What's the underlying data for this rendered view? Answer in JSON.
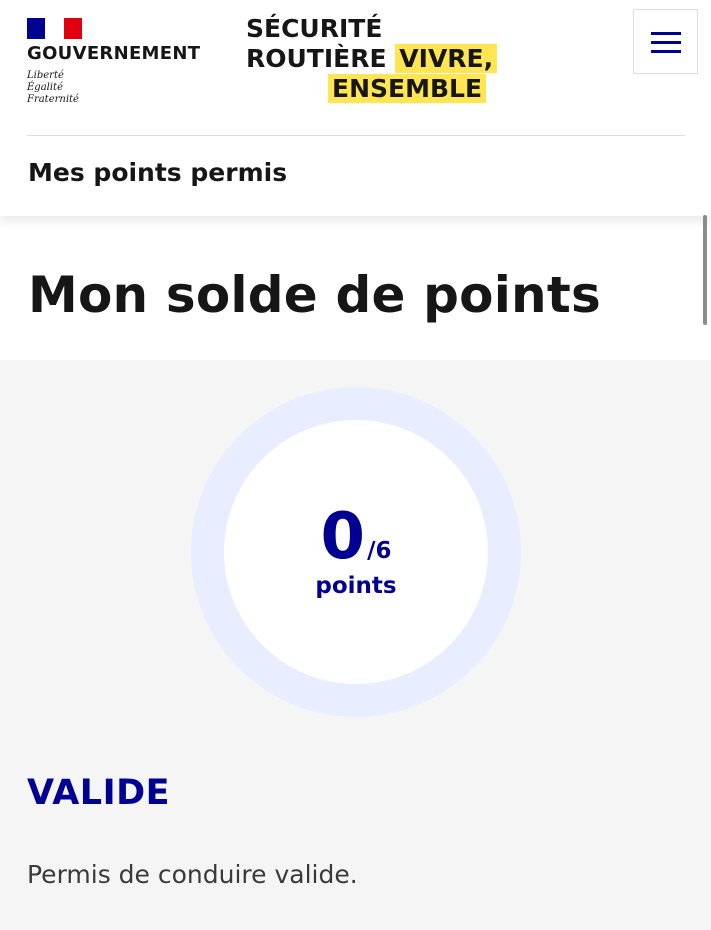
{
  "header": {
    "gov_name": "GOUVERNEMENT",
    "motto": [
      "Liberté",
      "Égalité",
      "Fraternité"
    ],
    "brand": {
      "line1": "SÉCURITÉ",
      "line2_plain": "ROUTIÈRE",
      "line2_highlight": "VIVRE,",
      "line3_highlight": "ENSEMBLE"
    },
    "menu_icon": "hamburger-icon",
    "service_title": "Mes points permis"
  },
  "main": {
    "page_title": "Mon solde de points",
    "points": {
      "value": "0",
      "max_label": "/6",
      "unit": "points"
    },
    "status": "VALIDE",
    "status_text": "Permis de conduire valide."
  },
  "colors": {
    "blue_france": "#000091",
    "red_marianne": "#e1000f",
    "highlight_yellow": "#ffe552",
    "ring": "#e8edff",
    "panel_bg": "#f5f5f5"
  }
}
